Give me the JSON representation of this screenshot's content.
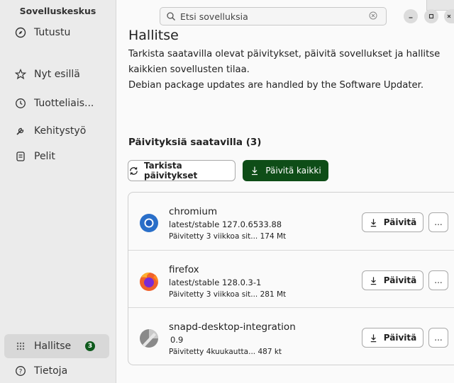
{
  "sidebar": {
    "title": "Sovelluskeskus",
    "items": [
      {
        "label": "Tutustu",
        "icon": "compass-icon"
      },
      {
        "label": "Nyt esillä",
        "icon": "star-icon"
      },
      {
        "label": "Tuotteliais...",
        "icon": "clock-icon"
      },
      {
        "label": "Kehitystyö",
        "icon": "wrench-icon"
      },
      {
        "label": "Pelit",
        "icon": "gamepad-icon"
      }
    ],
    "bottom_items": [
      {
        "label": "Hallitse",
        "icon": "grid-icon",
        "badge": "3",
        "active": true
      },
      {
        "label": "Tietoja",
        "icon": "help-icon"
      }
    ]
  },
  "search": {
    "placeholder": "Etsi sovelluksia"
  },
  "main": {
    "title": "Hallitse",
    "description_line1": "Tarkista saatavilla olevat päivitykset, päivitä sovellukset ja hallitse kaikkien sovellusten tilaa.",
    "description_line2": "Debian package updates are handled by the Software Updater.",
    "updates_title": "Päivityksiä saatavilla (3)",
    "check_button": "Tarkista päivitykset",
    "update_all_button": "Päivitä kaikki"
  },
  "updates": [
    {
      "name": "chromium",
      "version": "latest/stable 127.0.6533.88",
      "meta": "Päivitetty 3 viikkoa sit... 174 Mt",
      "button": "Päivitä",
      "icon": "chromium-icon"
    },
    {
      "name": "firefox",
      "version": "latest/stable 128.0.3-1",
      "meta": "Päivitetty 3 viikkoa sit... 281 Mt",
      "button": "Päivitä",
      "icon": "firefox-icon"
    },
    {
      "name": "snapd-desktop-integration",
      "version": "0.9",
      "meta": "Päivitetty 4kuukautta... 487 kt",
      "button": "Päivitä",
      "icon": "snapd-icon"
    }
  ],
  "more_label": "...",
  "colors": {
    "accent": "#0e4d17",
    "sidebar_bg": "#ebebeb",
    "badge": "#0e5a1c"
  }
}
